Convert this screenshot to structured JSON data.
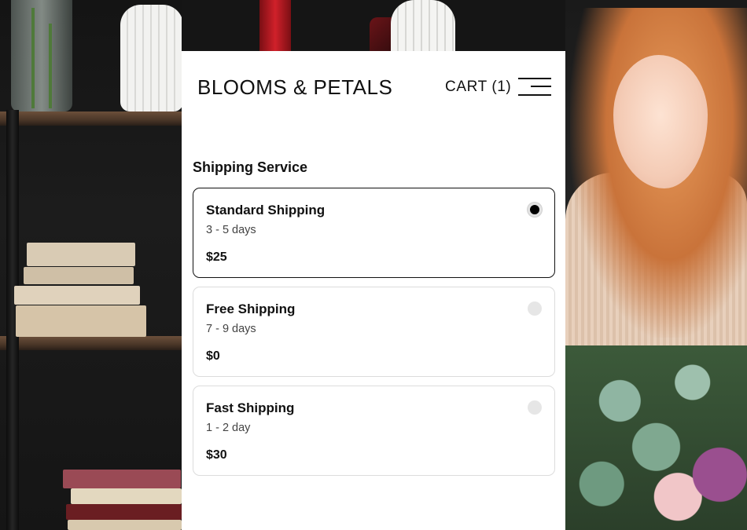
{
  "header": {
    "brand": "BLOOMS & PETALS",
    "cart_label": "CART (1)"
  },
  "shipping": {
    "title": "Shipping Service",
    "selected": "standard",
    "options": [
      {
        "id": "standard",
        "name": "Standard Shipping",
        "days": "3 - 5 days",
        "price": "$25"
      },
      {
        "id": "free",
        "name": "Free Shipping",
        "days": "7 - 9 days",
        "price": "$0"
      },
      {
        "id": "fast",
        "name": "Fast Shipping",
        "days": "1 - 2 day",
        "price": "$30"
      }
    ]
  }
}
